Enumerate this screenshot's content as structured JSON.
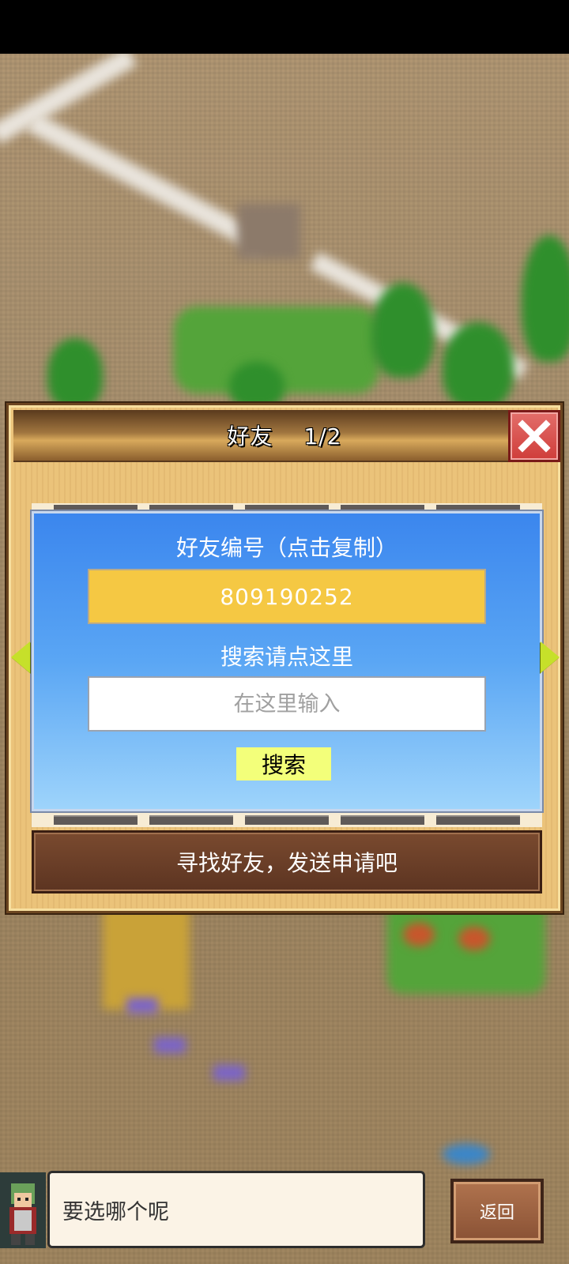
{
  "dialog": {
    "title": "好友　 1/2",
    "close_icon": "close-x-icon"
  },
  "friend_card": {
    "id_label": "好友编号（点击复制）",
    "id_value": "809190252",
    "search_label": "搜索请点这里",
    "search_placeholder": "在这里输入",
    "search_value": "",
    "search_button": "搜索"
  },
  "hint": "寻找好友，发送申请吧",
  "nav": {
    "prev_icon": "arrow-left-icon",
    "next_icon": "arrow-right-icon"
  },
  "bottom": {
    "speech": "要选哪个呢",
    "back_button": "返回"
  },
  "colors": {
    "id_box": "#f5c843",
    "search_button": "#f3ff7a",
    "close_button": "#cf3d3a",
    "nav_arrow": "#c6e02a"
  }
}
